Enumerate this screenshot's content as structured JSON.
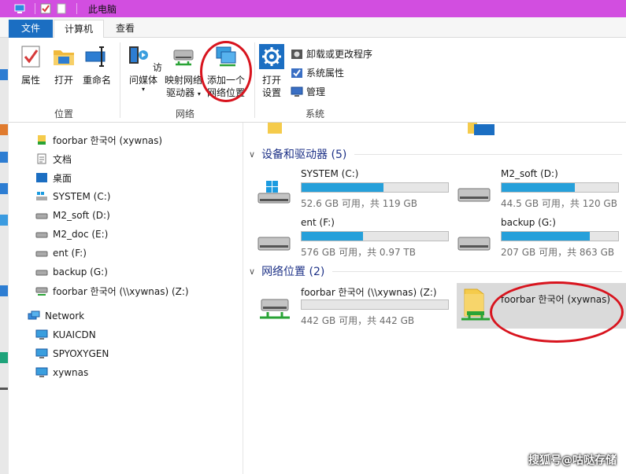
{
  "window": {
    "title": "此电脑"
  },
  "tabs": {
    "file": "文件",
    "computer": "计算机",
    "view": "查看"
  },
  "ribbon": {
    "location": {
      "label": "位置",
      "properties": "属性",
      "open": "打开",
      "rename": "重命名"
    },
    "network": {
      "label": "网络",
      "media_line1": "访问媒体",
      "map_line1": "映射网络",
      "map_line2": "驱动器",
      "add_line1": "添加一个",
      "add_line2": "网络位置"
    },
    "system": {
      "label": "系统",
      "open_settings_line1": "打开",
      "open_settings_line2": "设置",
      "uninstall": "卸载或更改程序",
      "system_properties": "系统属性",
      "manage": "管理"
    }
  },
  "nav": {
    "items": [
      {
        "label": "foorbar 한국어 (xywnas)"
      },
      {
        "label": "文档"
      },
      {
        "label": "桌面"
      },
      {
        "label": "SYSTEM (C:)"
      },
      {
        "label": "M2_soft (D:)"
      },
      {
        "label": "M2_doc (E:)"
      },
      {
        "label": "ent (F:)"
      },
      {
        "label": "backup (G:)"
      },
      {
        "label": "foorbar 한국어 (\\\\xywnas) (Z:)"
      }
    ],
    "network": {
      "label": "Network",
      "computers": [
        {
          "label": "KUAICDN"
        },
        {
          "label": "SPYOXYGEN"
        },
        {
          "label": "xywnas"
        }
      ]
    }
  },
  "sections": {
    "devices": {
      "title": "设备和驱动器 (5)"
    },
    "netlocs": {
      "title": "网络位置 (2)"
    }
  },
  "drives": [
    {
      "name": "SYSTEM (C:)",
      "size": "52.6 GB 可用，共 119 GB",
      "used_fraction": 0.56
    },
    {
      "name": "M2_soft (D:)",
      "size": "44.5 GB 可用，共 120 GB",
      "used_fraction": 0.63
    },
    {
      "name": "ent (F:)",
      "size": "576 GB 可用，共 0.97 TB",
      "used_fraction": 0.42
    },
    {
      "name": "backup (G:)",
      "size": "207 GB 可用，共 863 GB",
      "used_fraction": 0.76
    }
  ],
  "network_drive": {
    "name": "foorbar 한국어 (\\\\xywnas) (Z:)",
    "size": "442 GB 可用，共 442 GB",
    "used_fraction": 0.0
  },
  "network_location": {
    "name": "foorbar 한국어 (xywnas)"
  },
  "watermark": "搜狐号@咕哒存储",
  "colors": {
    "titlebar": "#d24ee0",
    "file_tab": "#1b6ec2",
    "bar_fill": "#26a0da",
    "annotation": "#d8141e",
    "section_title": "#1e3287"
  }
}
